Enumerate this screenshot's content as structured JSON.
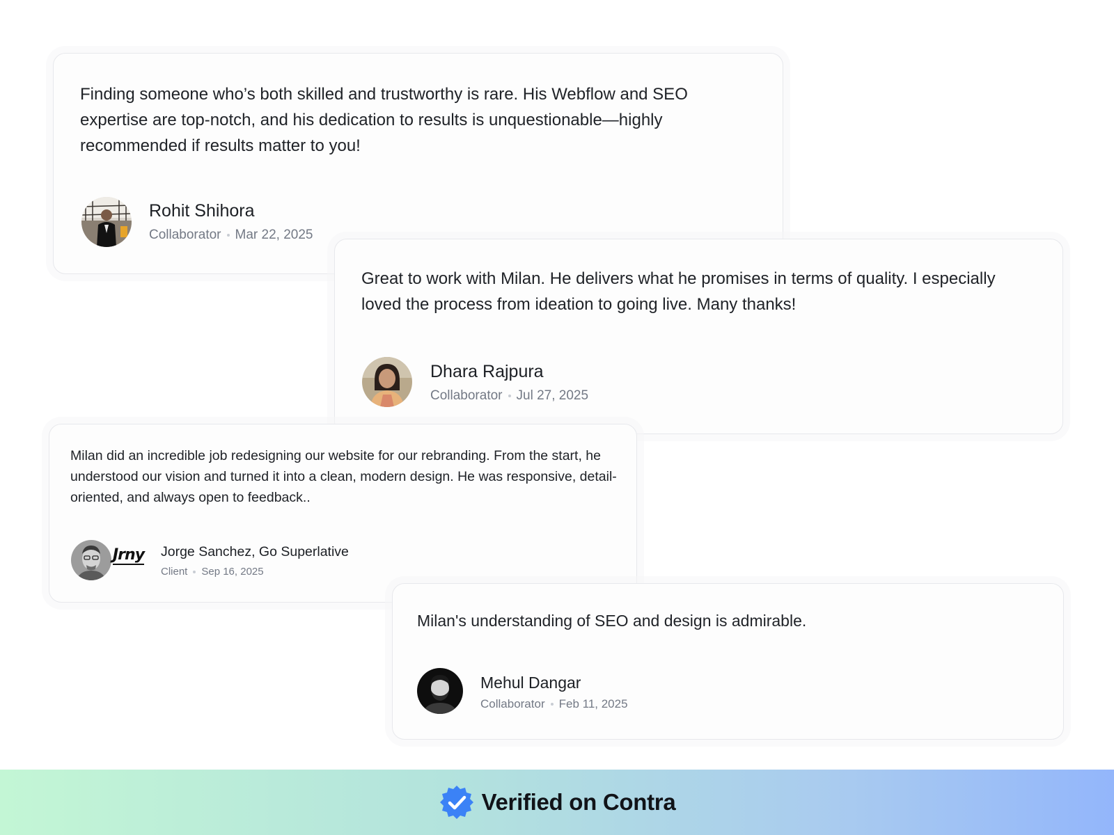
{
  "testimonials": [
    {
      "quote": "Finding someone who’s both skilled and trustworthy is rare. His Webflow and SEO expertise are top-notch, and his dedication to results is unquestionable—highly recommended if results matter to you!",
      "name": "Rohit Shihora",
      "role": "Collaborator",
      "date": "Mar 22, 2025"
    },
    {
      "quote": "Great to work with Milan. He delivers what he promises in terms of quality. I especially loved the process from ideation to going live. Many thanks!",
      "name": "Dhara Rajpura",
      "role": "Collaborator",
      "date": "Jul 27, 2025"
    },
    {
      "quote": "Milan did an incredible job redesigning our website for our rebranding. From the start, he understood our vision and turned it into a clean, modern design. He was responsive, detail-oriented, and always open to feedback..",
      "name": "Jorge Sanchez, Go Superlative",
      "role": "Client",
      "date": "Sep 16, 2025",
      "brand": "Jrny"
    },
    {
      "quote": "Milan's understanding of SEO and design is admirable.",
      "name": "Mehul Dangar",
      "role": "Collaborator",
      "date": "Feb 11, 2025"
    }
  ],
  "footer": {
    "text": "Verified on Contra",
    "badge_icon": "verified-badge-icon",
    "badge_color": "#3b82f6"
  }
}
